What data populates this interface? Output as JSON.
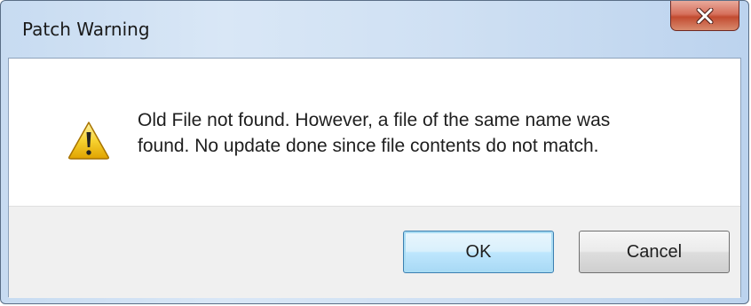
{
  "window": {
    "title": "Patch Warning",
    "close_icon": "close-icon"
  },
  "dialog": {
    "icon": "warning-icon",
    "message_lines": [
      "Old File not found.  However, a file of the same name was",
      "found. No update done since file contents do not match."
    ]
  },
  "buttons": {
    "ok_label": "OK",
    "cancel_label": "Cancel"
  },
  "colors": {
    "title_bar": "#cfe0f3",
    "close_button": "#c24b31",
    "warning_yellow": "#f5c518",
    "ok_border": "#3c7fb1"
  }
}
